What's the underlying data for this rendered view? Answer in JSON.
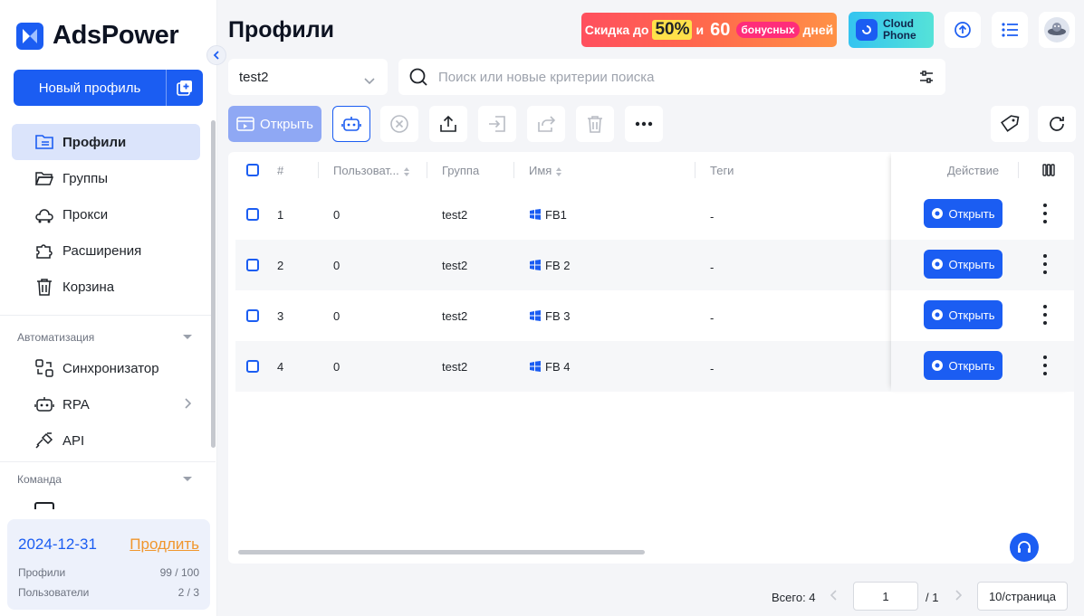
{
  "app": {
    "name": "AdsPower"
  },
  "sidebar": {
    "new_profile_label": "Новый профиль",
    "nav": [
      {
        "label": "Профили",
        "icon": "profiles-icon",
        "active": true
      },
      {
        "label": "Группы",
        "icon": "folder-icon"
      },
      {
        "label": "Прокси",
        "icon": "proxy-icon"
      },
      {
        "label": "Расширения",
        "icon": "puzzle-icon"
      },
      {
        "label": "Корзина",
        "icon": "trash-icon"
      }
    ],
    "automation_title": "Автоматизация",
    "automation": [
      {
        "label": "Синхронизатор",
        "icon": "sync-icon"
      },
      {
        "label": "RPA",
        "icon": "robot-icon"
      },
      {
        "label": "API",
        "icon": "api-plug-icon"
      }
    ],
    "team_title": "Команда",
    "subscription": {
      "date": "2024-12-31",
      "renew_label": "Продлить",
      "profiles_label": "Профили",
      "profiles_value": "99 / 100",
      "users_label": "Пользователи",
      "users_value": "2 / 3"
    }
  },
  "header": {
    "title": "Профили",
    "promo": {
      "prefix": "Скидка до",
      "discount": "50%",
      "and": "и",
      "days": "60",
      "bonus": "бонусных",
      "suffix": "дней"
    },
    "cloud_phone": {
      "line1": "Cloud",
      "line2": "Phone"
    }
  },
  "filters": {
    "group_value": "test2",
    "search_placeholder": "Поиск или новые критерии поиска"
  },
  "toolbar": {
    "open_label": "Открыть"
  },
  "table": {
    "columns": {
      "num": "#",
      "user": "Пользоват...",
      "group": "Группа",
      "name": "Имя",
      "tags": "Теги",
      "action": "Действие"
    },
    "rows": [
      {
        "num": "1",
        "user": "0",
        "group": "test2",
        "name": "FB1",
        "tags": "-",
        "action": "Открыть"
      },
      {
        "num": "2",
        "user": "0",
        "group": "test2",
        "name": "FB 2",
        "tags": "-",
        "action": "Открыть"
      },
      {
        "num": "3",
        "user": "0",
        "group": "test2",
        "name": "FB 3",
        "tags": "-",
        "action": "Открыть"
      },
      {
        "num": "4",
        "user": "0",
        "group": "test2",
        "name": "FB 4",
        "tags": "-",
        "action": "Открыть"
      }
    ]
  },
  "pagination": {
    "total": "Всего: 4",
    "page": "1",
    "of": "/ 1",
    "per_page": "10/страница"
  },
  "colors": {
    "accent": "#1b5df2",
    "renew": "#f0962d",
    "open_disabled": "#8fa8f4"
  }
}
